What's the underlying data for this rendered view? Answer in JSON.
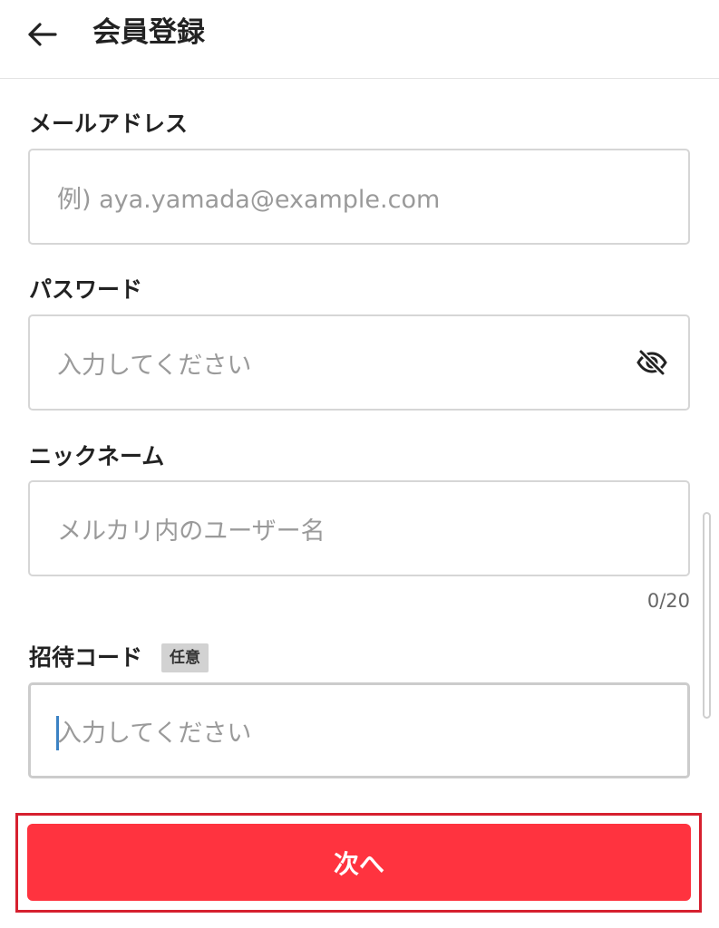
{
  "header": {
    "title": "会員登録",
    "back_icon": "arrow-left-icon"
  },
  "form": {
    "email": {
      "label": "メールアドレス",
      "placeholder": "例) aya.yamada@example.com",
      "value": ""
    },
    "password": {
      "label": "パスワード",
      "placeholder": "入力してください",
      "value": "",
      "toggle_icon": "eye-off-icon"
    },
    "nickname": {
      "label": "ニックネーム",
      "placeholder": "メルカリ内のユーザー名",
      "value": "",
      "counter": "0/20"
    },
    "invite_code": {
      "label": "招待コード",
      "badge": "任意",
      "placeholder": "入力してください",
      "value": ""
    }
  },
  "actions": {
    "next_label": "次へ"
  },
  "colors": {
    "primary": "#ff333f",
    "highlight_border": "#d6202f",
    "caret": "#3b82c4"
  }
}
